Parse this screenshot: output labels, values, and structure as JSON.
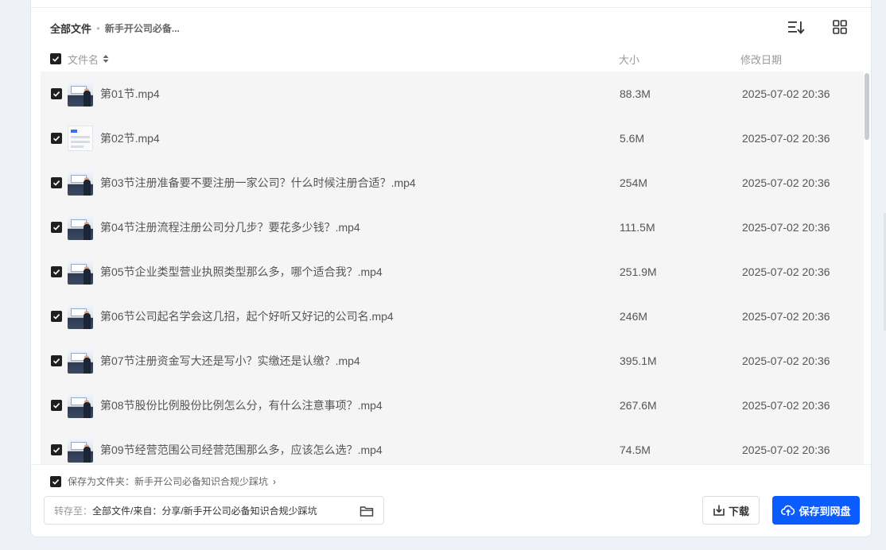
{
  "breadcrumb": {
    "root": "全部文件",
    "current": "新手开公司必备..."
  },
  "table": {
    "headers": {
      "name": "文件名",
      "size": "大小",
      "date": "修改日期"
    },
    "rows": [
      {
        "name": "第01节.mp4",
        "size": "88.3M",
        "date": "2025-07-02 20:36",
        "thumb": "video"
      },
      {
        "name": "第02节.mp4",
        "size": "5.6M",
        "date": "2025-07-02 20:36",
        "thumb": "screenshot"
      },
      {
        "name": "第03节注册准备要不要注册一家公司？什么时候注册合适？.mp4",
        "size": "254M",
        "date": "2025-07-02 20:36",
        "thumb": "video"
      },
      {
        "name": "第04节注册流程注册公司分几步？要花多少钱？.mp4",
        "size": "111.5M",
        "date": "2025-07-02 20:36",
        "thumb": "video"
      },
      {
        "name": "第05节企业类型营业执照类型那么多，哪个适合我？.mp4",
        "size": "251.9M",
        "date": "2025-07-02 20:36",
        "thumb": "video"
      },
      {
        "name": "第06节公司起名学会这几招，起个好听又好记的公司名.mp4",
        "size": "246M",
        "date": "2025-07-02 20:36",
        "thumb": "video"
      },
      {
        "name": "第07节注册资金写大还是写小？实缴还是认缴？.mp4",
        "size": "395.1M",
        "date": "2025-07-02 20:36",
        "thumb": "video"
      },
      {
        "name": "第08节股份比例股份比例怎么分，有什么注意事项？.mp4",
        "size": "267.6M",
        "date": "2025-07-02 20:36",
        "thumb": "video"
      },
      {
        "name": "第09节经营范围公司经营范围那么多，应该怎么选？.mp4",
        "size": "74.5M",
        "date": "2025-07-02 20:36",
        "thumb": "video"
      }
    ]
  },
  "footer": {
    "save_as_folder": "保存为文件夹：新手开公司必备知识合规少踩坑",
    "save_to_prefix": "转存至：",
    "save_to_path": "全部文件/来自：分享/新手开公司必备知识合规少踩坑",
    "download_label": "下载",
    "save_label": "保存到网盘"
  },
  "colors": {
    "primary": "#0b5cff",
    "row_bg": "#f5f5f6",
    "checkbox": "#1f1f1f"
  }
}
